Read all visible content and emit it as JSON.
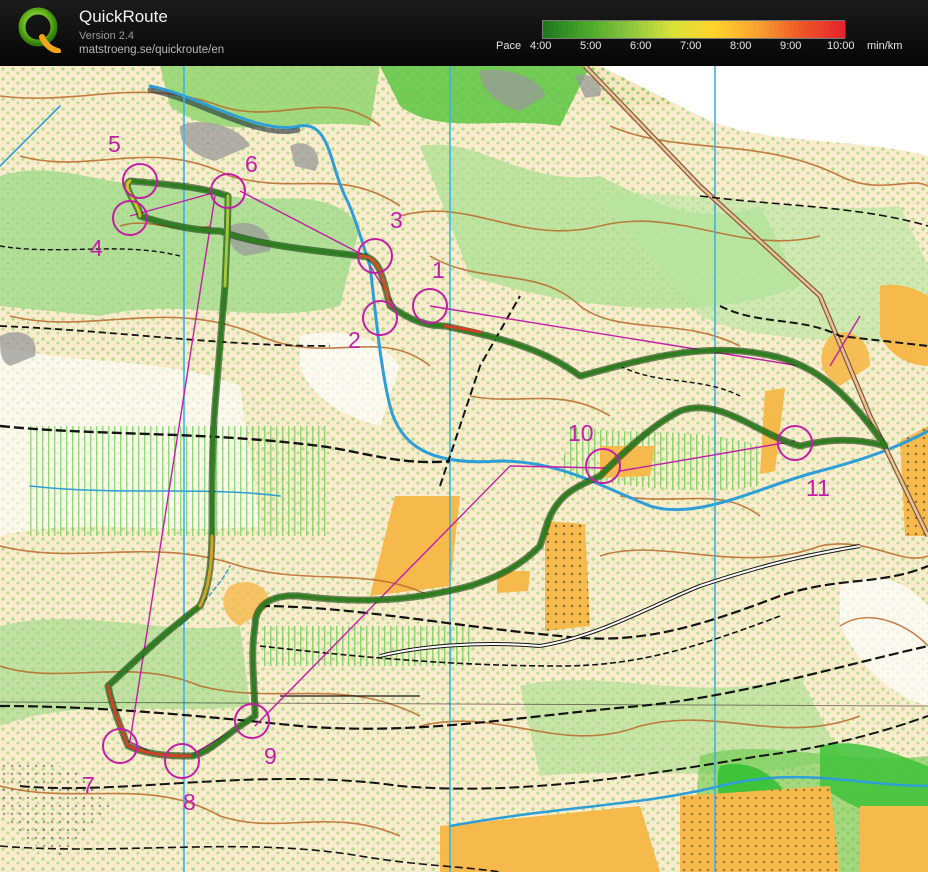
{
  "app": {
    "name": "QuickRoute",
    "version": "Version 2.4",
    "url": "matstroeng.se/quickroute/en"
  },
  "pace_legend": {
    "label": "Pace",
    "ticks": [
      "4:00",
      "5:00",
      "6:00",
      "7:00",
      "8:00",
      "9:00",
      "10:00"
    ],
    "unit": "min/km",
    "colors": [
      "#1f7a1f",
      "#4aa82b",
      "#8cc63f",
      "#d8e23a",
      "#ffd32a",
      "#f8a131",
      "#ef5a29",
      "#e4262c"
    ]
  },
  "map": {
    "colors": {
      "open": "#f6b94b",
      "rough_open": "#fad7a0",
      "forest": "#ffffff",
      "green": "#8bd56a",
      "dark_green": "#3ec33a",
      "contour": "#b86a2a",
      "water": "#2e9fd6",
      "route": "#1e6b1e",
      "course": "#c21ea8",
      "meridian": "#39b4e6",
      "track": "#141414"
    },
    "controls": [
      {
        "label": "1"
      },
      {
        "label": "2"
      },
      {
        "label": "3"
      },
      {
        "label": "4"
      },
      {
        "label": "5"
      },
      {
        "label": "6"
      },
      {
        "label": "7"
      },
      {
        "label": "8"
      },
      {
        "label": "9"
      },
      {
        "label": "10"
      },
      {
        "label": "11"
      }
    ]
  }
}
